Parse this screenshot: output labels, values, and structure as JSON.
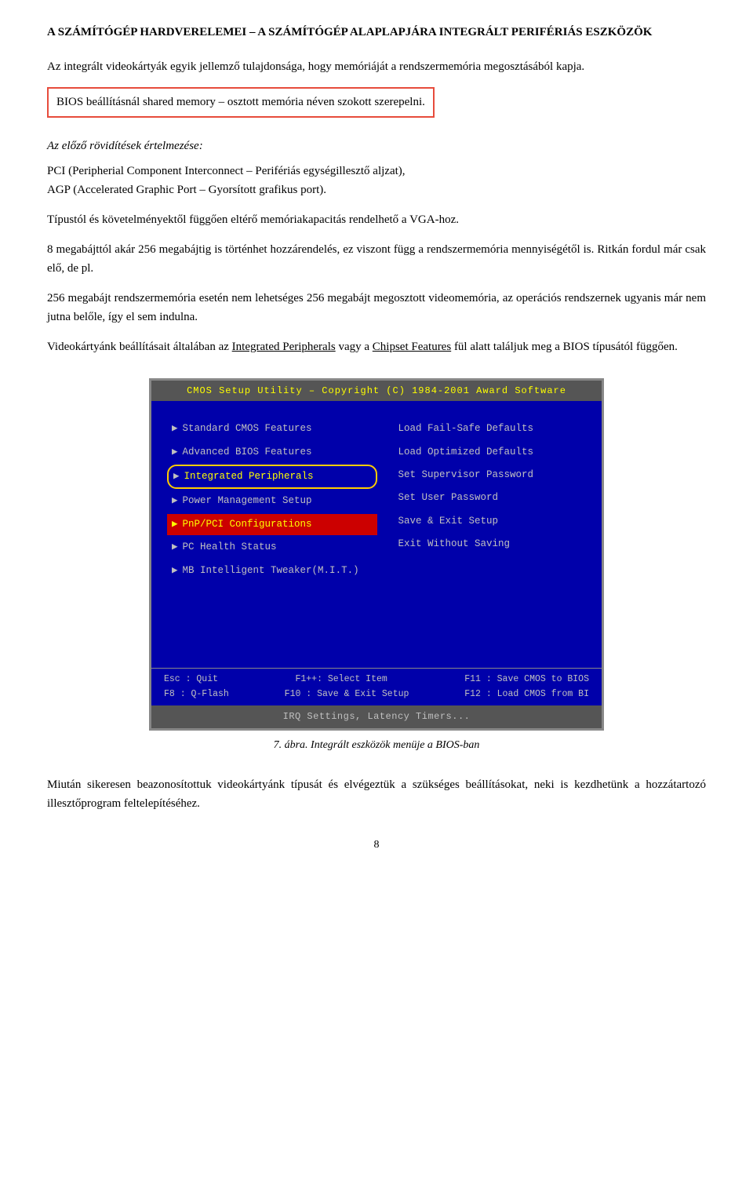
{
  "page": {
    "title": "A SZÁMÍTÓGÉP HARDVERELEMEI – A SZÁMÍTÓGÉP ALAPLAPJÁRA INTEGRÁLT PERIFÉRIÁS ESZKÖZÖK",
    "para1": "Az integrált videokártyák egyik jellemző tulajdonsága, hogy memóriáját a rendszermemória megosztásából kapja.",
    "para2_highlight": "BIOS beállításnál shared memory – osztott memória néven szokott szerepelni.",
    "section_heading": "Az előző rövidítések értelmezése:",
    "para3": "PCI (Peripherial Component Interconnect – Perifériás egységillesztő aljzat),",
    "para4": "AGP (Accelerated Graphic Port – Gyorsított grafikus port).",
    "para5": "Típustól és követelményektől függően eltérő memóriakapacitás rendelhető a VGA-hoz.",
    "para6": "8 megabájttól akár 256 megabájtig is történhet hozzárendelés, ez viszont függ a rendszermemória mennyiségétől is.",
    "para7": "Ritkán fordul már csak elő, de pl.",
    "para8": "256 megabájt rendszermemória esetén nem lehetséges 256 megabájt megosztott videomemória, az operációs rendszernek ugyanis már nem jutna belőle, így el sem indulna.",
    "para9_pre": "Videokártyánk beállításait általában az ",
    "para9_link1": "Integrated Peripherals",
    "para9_mid": " vagy a ",
    "para9_link2": "Chipset Features",
    "para9_post": " fül alatt találjuk meg a BIOS típusától függően.",
    "bios": {
      "title_bar": "CMOS Setup Utility – Copyright (C) 1984-2001 Award Software",
      "left_items": [
        {
          "label": "Standard CMOS Features",
          "style": "normal"
        },
        {
          "label": "Advanced BIOS Features",
          "style": "normal"
        },
        {
          "label": "Integrated Peripherals",
          "style": "oval"
        },
        {
          "label": "Power Management Setup",
          "style": "normal"
        },
        {
          "label": "PnP/PCI Configurations",
          "style": "red"
        },
        {
          "label": "PC Health Status",
          "style": "normal"
        },
        {
          "label": "MB Intelligent Tweaker(M.I.T.)",
          "style": "normal"
        }
      ],
      "right_items": [
        "Load Fail-Safe Defaults",
        "Load Optimized Defaults",
        "Set Supervisor Password",
        "Set User Password",
        "Save & Exit Setup",
        "Exit Without Saving"
      ],
      "footer_lines": [
        {
          "left": "Esc : Quit",
          "right": "F11 : Save CMOS to BIOS"
        },
        {
          "left": "F8  : Q-Flash",
          "right": "F12 : Load CMOS from BI"
        }
      ],
      "footer_mid": "F1++: Select Item",
      "footer_mid2": "F10 : Save & Exit Setup",
      "bottom_bar": "IRQ Settings, Latency Timers..."
    },
    "figure_caption": "7. ábra. Integrált eszközök menüje a BIOS-ban",
    "para10": "Miután sikeresen beazonosítottuk videokártyánk típusát és elvégeztük a szükséges beállításokat, neki is kezdhetünk a hozzátartozó illesztőprogram feltelepítéséhez.",
    "page_number": "8"
  }
}
